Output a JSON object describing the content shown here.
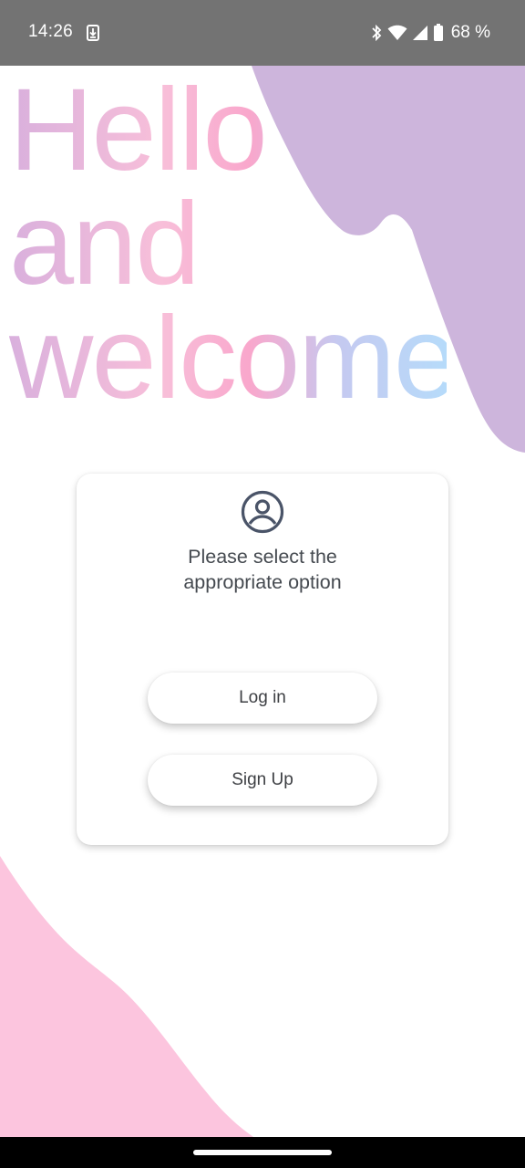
{
  "status_bar": {
    "time": "14:26",
    "battery": "68 %",
    "icons": [
      "download-icon",
      "bluetooth-icon",
      "wifi-icon",
      "signal-icon",
      "battery-icon"
    ],
    "background": "#737373"
  },
  "hero": {
    "line1": "Hello",
    "line2": "and",
    "line3": "welcome"
  },
  "card": {
    "icon": "account-circle-icon",
    "title_line1": "Please select the",
    "title_line2": "appropriate option",
    "login_label": "Log in",
    "signup_label": "Sign Up"
  },
  "colors": {
    "purple_blob": "#cdb5dc",
    "pink_blob": "#fcc5de",
    "text_dark": "#454a50",
    "icon_color": "#4a5468"
  }
}
